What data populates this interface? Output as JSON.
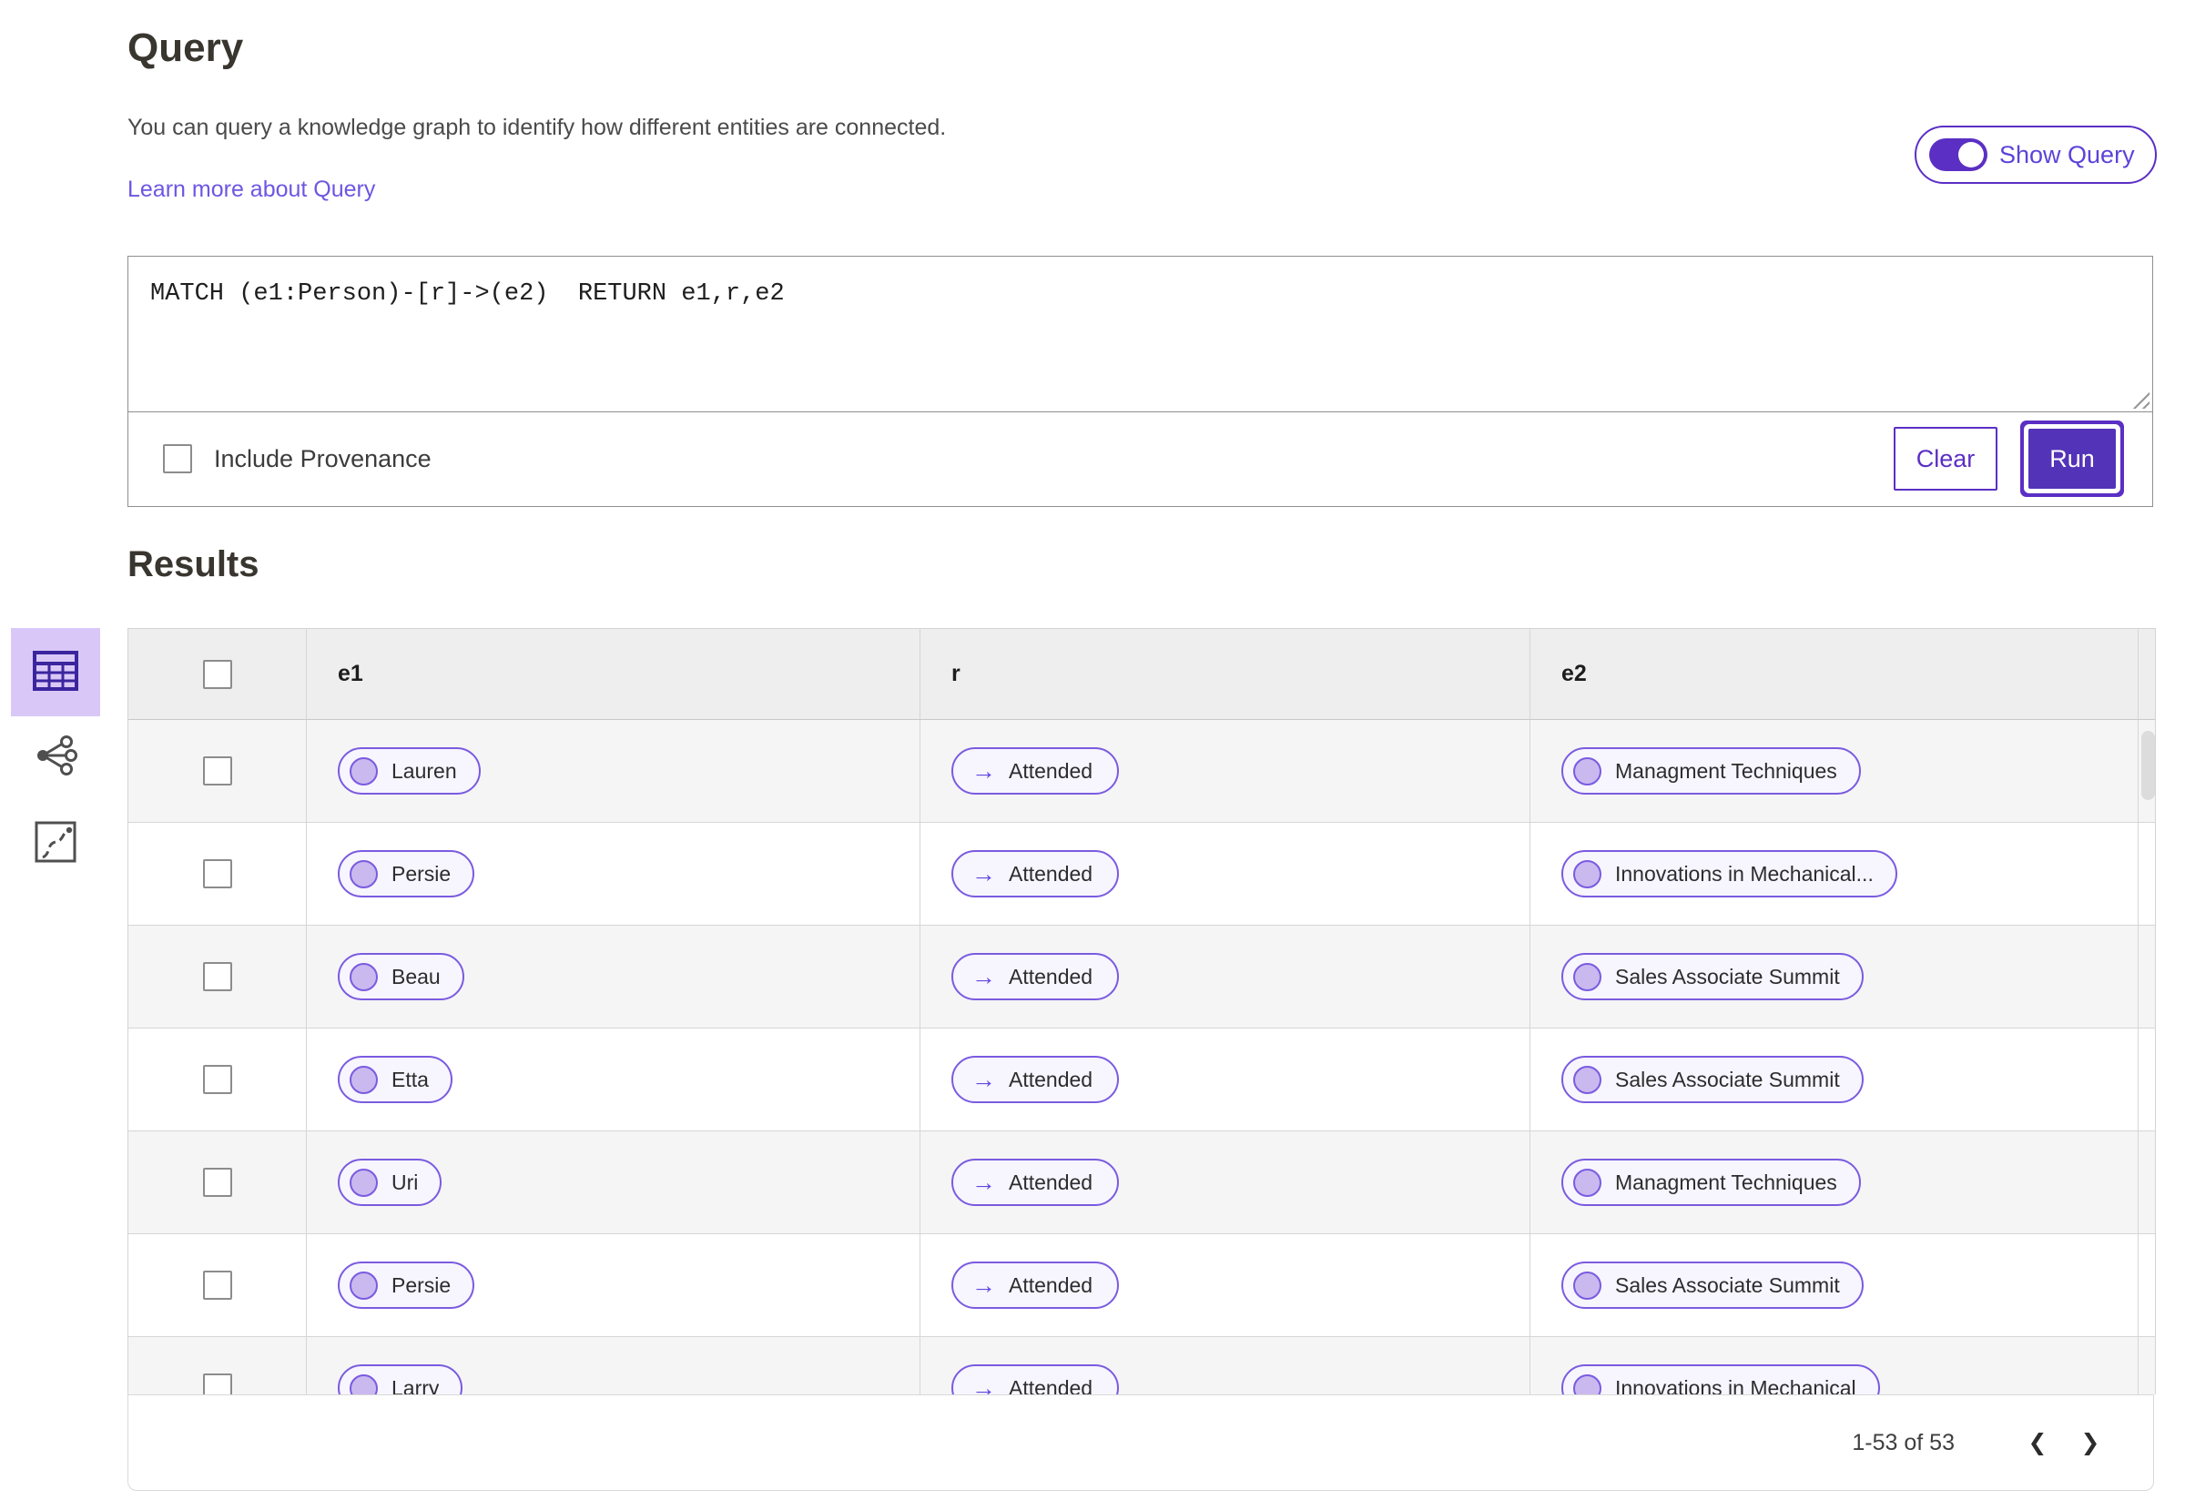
{
  "colors": {
    "accent_purple": "#5b2fc4",
    "run_button_bg": "#5333b8",
    "pill_border": "#7a5be0",
    "pill_background": "#f7f5fe",
    "pill_circle_fill": "#c9b9ef",
    "link_purple": "#6d56e3",
    "selected_view_bg": "#d9c8f7",
    "selected_view_icon": "#3b259e",
    "table_header_bg": "#eeeeee",
    "alt_row_bg": "#f5f5f5"
  },
  "icons": {
    "arrow_right": "→",
    "chevron_left": "❮",
    "chevron_right": "❯"
  },
  "query_section": {
    "title": "Query",
    "description": "You can query a knowledge graph to identify how different entities are connected.",
    "learn_more_link": "Learn more about Query",
    "show_query_toggle": {
      "label": "Show Query",
      "state": "on"
    },
    "query_input": "MATCH (e1:Person)-[r]->(e2)  RETURN e1,r,e2",
    "include_provenance": {
      "label": "Include Provenance",
      "checked": false
    },
    "clear_button": "Clear",
    "run_button": "Run"
  },
  "results_section": {
    "title": "Results",
    "view_switcher": [
      {
        "name": "table-view",
        "selected": true
      },
      {
        "name": "network-view",
        "selected": false
      },
      {
        "name": "path-view",
        "selected": false
      }
    ],
    "table": {
      "columns": [
        "e1",
        "r",
        "e2"
      ],
      "rows": [
        {
          "e1": "Lauren",
          "r": "Attended",
          "e2": "Managment Techniques"
        },
        {
          "e1": "Persie",
          "r": "Attended",
          "e2": "Innovations in Mechanical..."
        },
        {
          "e1": "Beau",
          "r": "Attended",
          "e2": "Sales Associate Summit"
        },
        {
          "e1": "Etta",
          "r": "Attended",
          "e2": "Sales Associate Summit"
        },
        {
          "e1": "Uri",
          "r": "Attended",
          "e2": "Managment Techniques"
        },
        {
          "e1": "Persie",
          "r": "Attended",
          "e2": "Sales Associate Summit"
        },
        {
          "e1": "Larry",
          "r": "Attended",
          "e2": "Innovations in Mechanical"
        }
      ]
    },
    "pagination": {
      "range_text": "1-53 of 53"
    }
  }
}
